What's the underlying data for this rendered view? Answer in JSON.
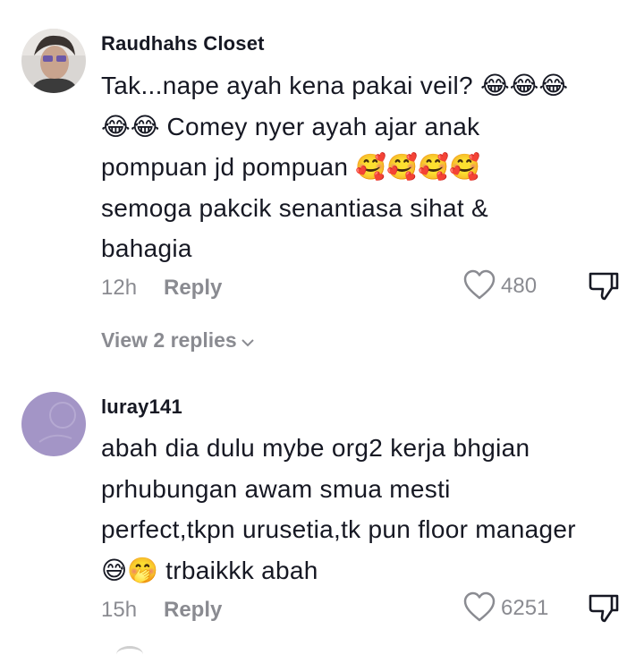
{
  "comments": [
    {
      "username": "Raudhahs Closet",
      "lines": [
        [
          {
            "t": "Tak...nape ayah kena pakai veil? "
          },
          {
            "e": "😂😂😂"
          }
        ],
        [
          {
            "e": "😂😂"
          },
          {
            "t": " Comey nyer ayah ajar anak"
          }
        ],
        [
          {
            "t": "pompuan jd pompuan "
          },
          {
            "e": "🥰🥰🥰🥰"
          }
        ],
        [
          {
            "t": "semoga pakcik senantiasa sihat &"
          }
        ],
        [
          {
            "t": "bahagia"
          }
        ]
      ],
      "time": "12h",
      "reply_label": "Reply",
      "likes": "480",
      "view_replies": "View 2 replies"
    },
    {
      "username": "luray141",
      "lines": [
        [
          {
            "t": "abah dia dulu mybe org2 kerja bhgian"
          }
        ],
        [
          {
            "t": "prhubungan awam smua mesti"
          }
        ],
        [
          {
            "t": "perfect,tkpn urusetia,tk pun floor manager"
          }
        ],
        [
          {
            "e": "😅🤭"
          },
          {
            "t": " trbaikkk abah"
          }
        ]
      ],
      "time": "15h",
      "reply_label": "Reply",
      "likes": "6251"
    }
  ],
  "colors": {
    "text": "#161823",
    "muted": "#8a8b91",
    "avatar2": "#a08fc4"
  },
  "icons": [
    "heart-outline-icon",
    "thumb-down-icon",
    "chevron-down-icon"
  ]
}
